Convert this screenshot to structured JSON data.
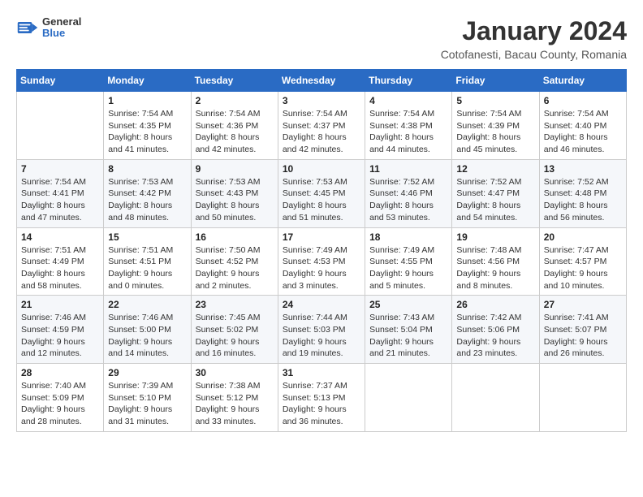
{
  "header": {
    "logo_general": "General",
    "logo_blue": "Blue",
    "month_year": "January 2024",
    "location": "Cotofanesti, Bacau County, Romania"
  },
  "weekdays": [
    "Sunday",
    "Monday",
    "Tuesday",
    "Wednesday",
    "Thursday",
    "Friday",
    "Saturday"
  ],
  "weeks": [
    [
      {
        "day": "",
        "info": ""
      },
      {
        "day": "1",
        "info": "Sunrise: 7:54 AM\nSunset: 4:35 PM\nDaylight: 8 hours\nand 41 minutes."
      },
      {
        "day": "2",
        "info": "Sunrise: 7:54 AM\nSunset: 4:36 PM\nDaylight: 8 hours\nand 42 minutes."
      },
      {
        "day": "3",
        "info": "Sunrise: 7:54 AM\nSunset: 4:37 PM\nDaylight: 8 hours\nand 42 minutes."
      },
      {
        "day": "4",
        "info": "Sunrise: 7:54 AM\nSunset: 4:38 PM\nDaylight: 8 hours\nand 44 minutes."
      },
      {
        "day": "5",
        "info": "Sunrise: 7:54 AM\nSunset: 4:39 PM\nDaylight: 8 hours\nand 45 minutes."
      },
      {
        "day": "6",
        "info": "Sunrise: 7:54 AM\nSunset: 4:40 PM\nDaylight: 8 hours\nand 46 minutes."
      }
    ],
    [
      {
        "day": "7",
        "info": "Sunrise: 7:54 AM\nSunset: 4:41 PM\nDaylight: 8 hours\nand 47 minutes."
      },
      {
        "day": "8",
        "info": "Sunrise: 7:53 AM\nSunset: 4:42 PM\nDaylight: 8 hours\nand 48 minutes."
      },
      {
        "day": "9",
        "info": "Sunrise: 7:53 AM\nSunset: 4:43 PM\nDaylight: 8 hours\nand 50 minutes."
      },
      {
        "day": "10",
        "info": "Sunrise: 7:53 AM\nSunset: 4:45 PM\nDaylight: 8 hours\nand 51 minutes."
      },
      {
        "day": "11",
        "info": "Sunrise: 7:52 AM\nSunset: 4:46 PM\nDaylight: 8 hours\nand 53 minutes."
      },
      {
        "day": "12",
        "info": "Sunrise: 7:52 AM\nSunset: 4:47 PM\nDaylight: 8 hours\nand 54 minutes."
      },
      {
        "day": "13",
        "info": "Sunrise: 7:52 AM\nSunset: 4:48 PM\nDaylight: 8 hours\nand 56 minutes."
      }
    ],
    [
      {
        "day": "14",
        "info": "Sunrise: 7:51 AM\nSunset: 4:49 PM\nDaylight: 8 hours\nand 58 minutes."
      },
      {
        "day": "15",
        "info": "Sunrise: 7:51 AM\nSunset: 4:51 PM\nDaylight: 9 hours\nand 0 minutes."
      },
      {
        "day": "16",
        "info": "Sunrise: 7:50 AM\nSunset: 4:52 PM\nDaylight: 9 hours\nand 2 minutes."
      },
      {
        "day": "17",
        "info": "Sunrise: 7:49 AM\nSunset: 4:53 PM\nDaylight: 9 hours\nand 3 minutes."
      },
      {
        "day": "18",
        "info": "Sunrise: 7:49 AM\nSunset: 4:55 PM\nDaylight: 9 hours\nand 5 minutes."
      },
      {
        "day": "19",
        "info": "Sunrise: 7:48 AM\nSunset: 4:56 PM\nDaylight: 9 hours\nand 8 minutes."
      },
      {
        "day": "20",
        "info": "Sunrise: 7:47 AM\nSunset: 4:57 PM\nDaylight: 9 hours\nand 10 minutes."
      }
    ],
    [
      {
        "day": "21",
        "info": "Sunrise: 7:46 AM\nSunset: 4:59 PM\nDaylight: 9 hours\nand 12 minutes."
      },
      {
        "day": "22",
        "info": "Sunrise: 7:46 AM\nSunset: 5:00 PM\nDaylight: 9 hours\nand 14 minutes."
      },
      {
        "day": "23",
        "info": "Sunrise: 7:45 AM\nSunset: 5:02 PM\nDaylight: 9 hours\nand 16 minutes."
      },
      {
        "day": "24",
        "info": "Sunrise: 7:44 AM\nSunset: 5:03 PM\nDaylight: 9 hours\nand 19 minutes."
      },
      {
        "day": "25",
        "info": "Sunrise: 7:43 AM\nSunset: 5:04 PM\nDaylight: 9 hours\nand 21 minutes."
      },
      {
        "day": "26",
        "info": "Sunrise: 7:42 AM\nSunset: 5:06 PM\nDaylight: 9 hours\nand 23 minutes."
      },
      {
        "day": "27",
        "info": "Sunrise: 7:41 AM\nSunset: 5:07 PM\nDaylight: 9 hours\nand 26 minutes."
      }
    ],
    [
      {
        "day": "28",
        "info": "Sunrise: 7:40 AM\nSunset: 5:09 PM\nDaylight: 9 hours\nand 28 minutes."
      },
      {
        "day": "29",
        "info": "Sunrise: 7:39 AM\nSunset: 5:10 PM\nDaylight: 9 hours\nand 31 minutes."
      },
      {
        "day": "30",
        "info": "Sunrise: 7:38 AM\nSunset: 5:12 PM\nDaylight: 9 hours\nand 33 minutes."
      },
      {
        "day": "31",
        "info": "Sunrise: 7:37 AM\nSunset: 5:13 PM\nDaylight: 9 hours\nand 36 minutes."
      },
      {
        "day": "",
        "info": ""
      },
      {
        "day": "",
        "info": ""
      },
      {
        "day": "",
        "info": ""
      }
    ]
  ]
}
